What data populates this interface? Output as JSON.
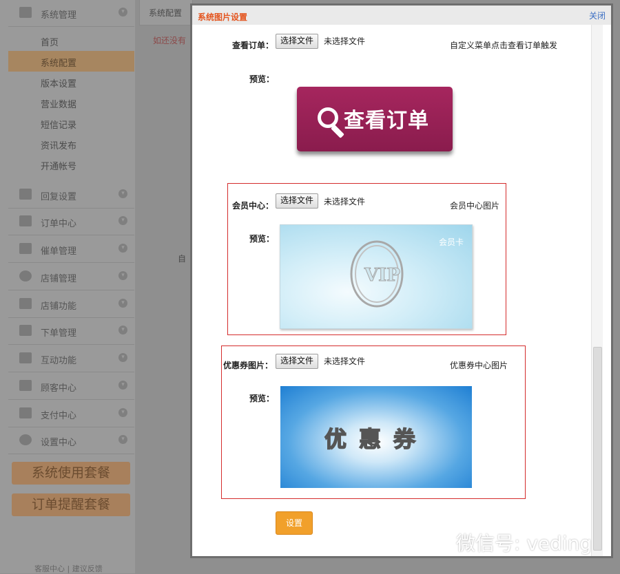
{
  "sidebar": {
    "system_management": "系统管理",
    "sub_items": [
      "首页",
      "系统配置",
      "版本设置",
      "营业数据",
      "短信记录",
      "资讯发布",
      "开通帐号"
    ],
    "sections": [
      "回复设置",
      "订单中心",
      "催单管理",
      "店铺管理",
      "店铺功能",
      "下单管理",
      "互动功能",
      "顾客中心",
      "支付中心",
      "设置中心"
    ],
    "package_buttons": [
      "系统使用套餐",
      "订单提醒套餐"
    ],
    "footer": "客服中心 | 建议反馈"
  },
  "main": {
    "tab": "系统配置",
    "hint": "如还没有",
    "bg_label": "自"
  },
  "dialog": {
    "title": "系统图片设置",
    "close": "关闭",
    "choose_file": "选择文件",
    "no_file": "未选择文件",
    "preview": "预览：",
    "order": {
      "label": "查看订单：",
      "hint": "自定义菜单点击查看订单触发",
      "image_text": "查看订单"
    },
    "member": {
      "label": "会员中心：",
      "hint": "会员中心图片",
      "card_label": "会员卡",
      "vip_text": "VIP"
    },
    "coupon": {
      "label": "优惠券图片：",
      "hint": "优惠券中心图片",
      "image_text": "优惠券"
    },
    "submit": "设置"
  },
  "watermark": {
    "text": "微信号: veding"
  },
  "colors": {
    "accent": "#e4551f",
    "link": "#3a6ec3",
    "button": "#f1a02b",
    "highlight_border": "#d42b2b"
  }
}
